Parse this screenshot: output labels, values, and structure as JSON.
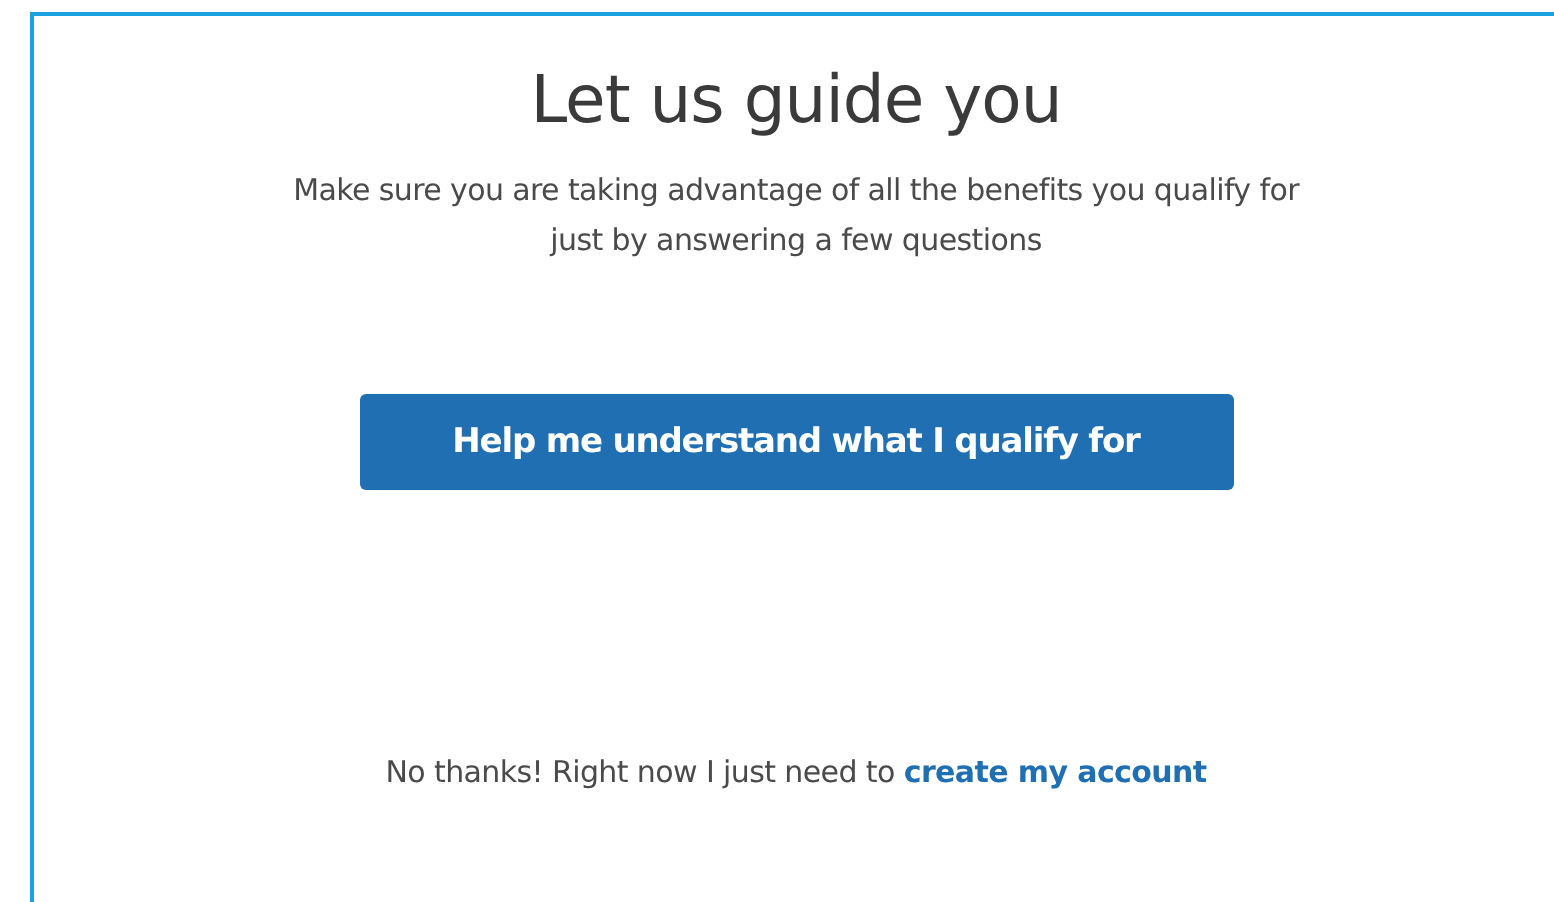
{
  "title": "Let us guide you",
  "subtitle_lines": [
    "Make sure you are taking advantage of all the benefits you qualify for",
    "just by answering a few questions"
  ],
  "primary_button": "Help me understand what I qualify for",
  "footer": {
    "text": "No thanks! Right now I just need to",
    "link": "create my account"
  }
}
